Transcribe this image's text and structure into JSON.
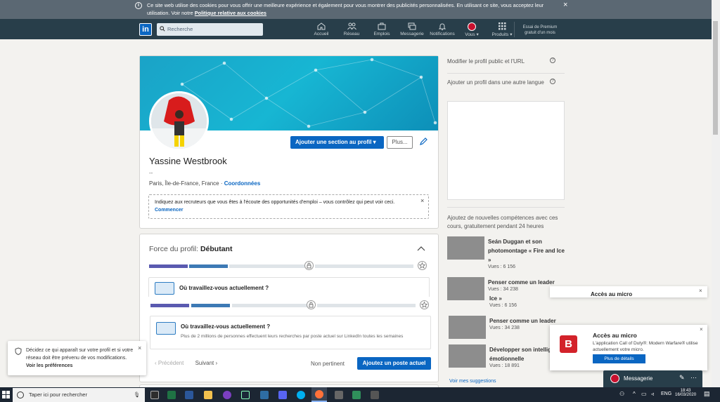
{
  "cookie": {
    "text": "Ce site web utilise des cookies pour vous offrir une meilleure expérience et également pour vous montrer des publicités personnalisées. En utilisant ce site, vous acceptez leur utilisation. Voir notre ",
    "link": "Politique relative aux cookies",
    "close": "×"
  },
  "nav": {
    "logo": "in",
    "search_placeholder": "Recherche",
    "items": [
      "Accueil",
      "Réseau",
      "Emplois",
      "Messagerie",
      "Notifications",
      "Vous",
      "Produits"
    ],
    "premium": "Essai de Premium gratuit d'un mois"
  },
  "profile": {
    "add_section": "Ajouter une section au profil",
    "more": "Plus...",
    "name": "Yassine Westbrook",
    "headline": "--",
    "location": "Paris, Île-de-France, France",
    "contact": "Coordonnées",
    "recruiter_text": "Indiquez aux recruteurs que vous êtes à l'écoute des opportunités d'emploi – vous contrôlez qui peut voir ceci.",
    "recruiter_link": "Commencer",
    "close": "×"
  },
  "strength": {
    "label": "Force du profil: ",
    "level": "Débutant",
    "question": "Où travaillez-vous actuellement ?",
    "desc": "Plus de 2 millions de personnes effectuent leurs recherches par poste actuel sur LinkedIn toutes les semaines",
    "prev": "‹ Précédent",
    "next": "Suivant ›",
    "dismiss": "Non pertinent",
    "add_position": "Ajoutez un poste actuel"
  },
  "right": {
    "edit_public": "Modifier le profil public et l'URL",
    "other_lang": "Ajouter un profil dans une autre langue",
    "skills": "Ajoutez de nouvelles compétences avec ces cours, gratuitement pendant 24 heures",
    "courses": [
      {
        "title": "Seán Duggan et son photomontage « Fire and Ice »",
        "views": "Vues : 6 156"
      },
      {
        "title": "Penser comme un leader",
        "views": "Vues : 34 238"
      },
      {
        "title": "Ice »",
        "views": "Vues : 6 156"
      },
      {
        "title": "Penser comme un leader",
        "views": "Vues : 34 238"
      },
      {
        "title": "Développer son intelligence émotionnelle",
        "views": "Vues : 18 891"
      }
    ],
    "more": "Voir mes suggestions"
  },
  "privacy_popup": {
    "text": "Décidez ce qui apparaît sur votre profil et si votre réseau doit être prévenu de vos modifications. ",
    "link": "Voir les préférences",
    "close": "×"
  },
  "toast": {
    "title": "Accès au micro",
    "text": "L'application Call of Duty®: Modern Warfare® utilise actuellement votre micro.",
    "button": "Plus de détails",
    "back_title": "Accès au micro",
    "close": "×"
  },
  "messaging": {
    "label": "Messagerie"
  },
  "taskbar": {
    "search": "Taper ici pour rechercher",
    "lang": "ENG",
    "time": "18:43",
    "date": "16/03/2020"
  },
  "colors": {
    "linkedin_blue": "#0a66c2",
    "nav_bg": "#283e4a",
    "taskbar": "#1c2633"
  }
}
